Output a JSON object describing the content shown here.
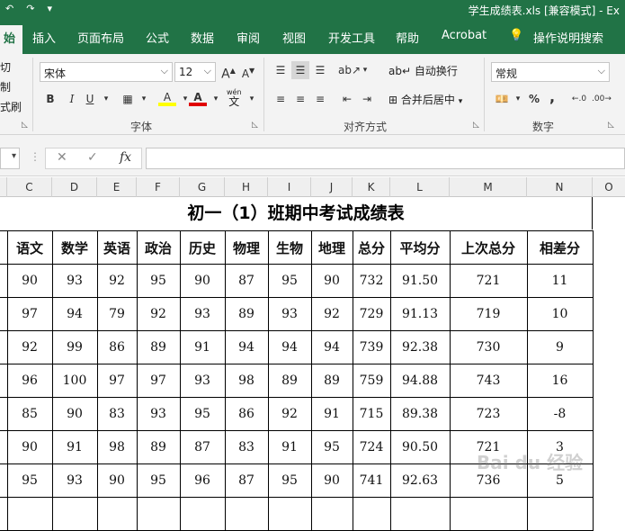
{
  "titlebar": {
    "doc_title": "学生成绩表.xls  [兼容模式]  - Ex"
  },
  "menu": {
    "tabs": [
      {
        "label": "始",
        "active": true
      },
      {
        "label": "插入"
      },
      {
        "label": "页面布局"
      },
      {
        "label": "公式"
      },
      {
        "label": "数据"
      },
      {
        "label": "审阅"
      },
      {
        "label": "视图"
      },
      {
        "label": "开发工具"
      },
      {
        "label": "帮助"
      },
      {
        "label": "Acrobat"
      },
      {
        "label": "操作说明搜索"
      }
    ]
  },
  "ribbon": {
    "clipboard": {
      "cut": "切",
      "copy": "制",
      "format_painter": "式刷"
    },
    "font": {
      "family": "宋体",
      "size": "12",
      "bold": "B",
      "italic": "I",
      "underline": "U",
      "wen": "wén",
      "wen_char": "文",
      "grow": "A",
      "shrink": "A",
      "font_color_glyph": "A",
      "highlight_glyph": "A",
      "group_label": "字体"
    },
    "alignment": {
      "wrap_text": "自动换行",
      "merge_center": "合并后居中",
      "group_label": "对齐方式"
    },
    "number": {
      "format": "常规",
      "percent": "%",
      "comma": ",",
      "group_label": "数字"
    }
  },
  "formula_bar": {
    "fx": "fx",
    "value": ""
  },
  "columns": [
    "C",
    "D",
    "E",
    "F",
    "G",
    "H",
    "I",
    "J",
    "K",
    "L",
    "M",
    "N",
    "O"
  ],
  "sheet": {
    "title": "初一（1）班期中考试成绩表",
    "headers": [
      "语文",
      "数学",
      "英语",
      "政治",
      "历史",
      "物理",
      "生物",
      "地理",
      "总分",
      "平均分",
      "上次总分",
      "相差分"
    ],
    "rows": [
      [
        "90",
        "93",
        "92",
        "95",
        "90",
        "87",
        "95",
        "90",
        "732",
        "91.50",
        "721",
        "11"
      ],
      [
        "97",
        "94",
        "79",
        "92",
        "93",
        "89",
        "93",
        "92",
        "729",
        "91.13",
        "719",
        "10"
      ],
      [
        "92",
        "99",
        "86",
        "89",
        "91",
        "94",
        "94",
        "94",
        "739",
        "92.38",
        "730",
        "9"
      ],
      [
        "96",
        "100",
        "97",
        "97",
        "93",
        "98",
        "89",
        "89",
        "759",
        "94.88",
        "743",
        "16"
      ],
      [
        "85",
        "90",
        "83",
        "93",
        "95",
        "86",
        "92",
        "91",
        "715",
        "89.38",
        "723",
        "-8"
      ],
      [
        "90",
        "91",
        "98",
        "89",
        "87",
        "83",
        "91",
        "95",
        "724",
        "90.50",
        "721",
        "3"
      ],
      [
        "95",
        "93",
        "90",
        "95",
        "96",
        "87",
        "95",
        "90",
        "741",
        "92.63",
        "736",
        "5"
      ],
      [
        "",
        "",
        "",
        "",
        "",
        "",
        "",
        "",
        "",
        "",
        "",
        ""
      ]
    ]
  },
  "watermark": "Bai du 经验",
  "colors": {
    "excel_green": "#217346",
    "ribbon_bg": "#f3f3f3",
    "font_color_bar": "#e00000",
    "highlight_bar": "#ffff00"
  }
}
